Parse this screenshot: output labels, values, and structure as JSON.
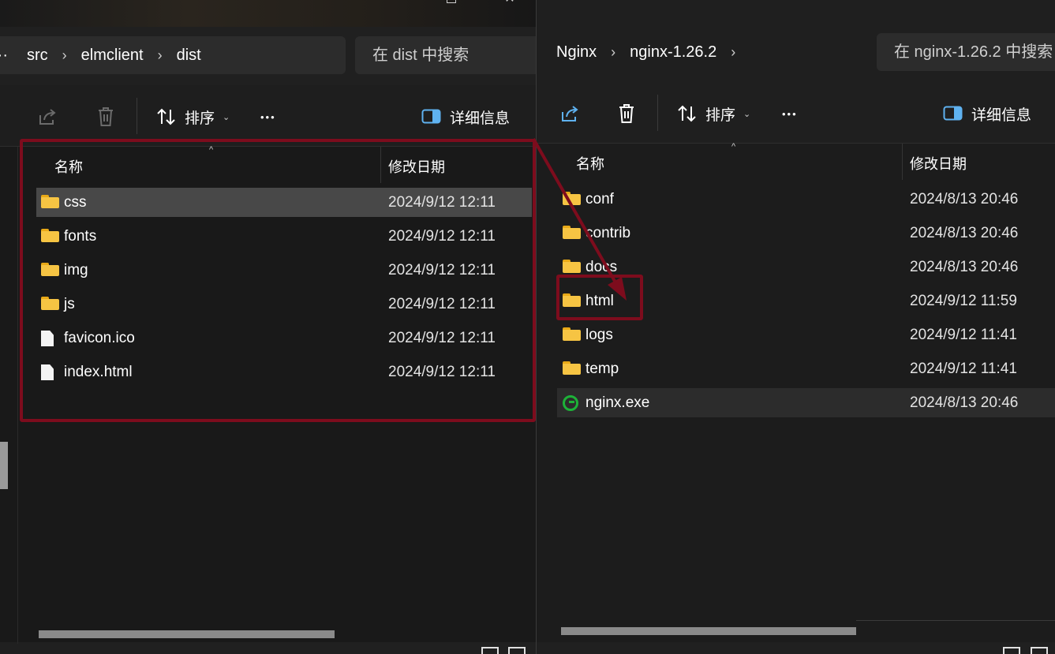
{
  "left_window": {
    "breadcrumb": {
      "overflow_label": "···",
      "items": [
        "src",
        "elmclient",
        "dist"
      ]
    },
    "search_placeholder": "在 dist 中搜索",
    "toolbar": {
      "sort_label": "排序",
      "more_label": "•••",
      "details_label": "详细信息"
    },
    "columns": {
      "name": "名称",
      "modified": "修改日期"
    },
    "files": [
      {
        "name": "css",
        "type": "folder",
        "modified": "2024/9/12 12:11",
        "selected": true
      },
      {
        "name": "fonts",
        "type": "folder",
        "modified": "2024/9/12 12:11"
      },
      {
        "name": "img",
        "type": "folder",
        "modified": "2024/9/12 12:11"
      },
      {
        "name": "js",
        "type": "folder",
        "modified": "2024/9/12 12:11"
      },
      {
        "name": "favicon.ico",
        "type": "file",
        "modified": "2024/9/12 12:11"
      },
      {
        "name": "index.html",
        "type": "file",
        "modified": "2024/9/12 12:11"
      }
    ]
  },
  "right_window": {
    "breadcrumb": {
      "items": [
        "Nginx",
        "nginx-1.26.2"
      ]
    },
    "search_placeholder": "在 nginx-1.26.2 中搜索",
    "toolbar": {
      "sort_label": "排序",
      "more_label": "•••",
      "details_label": "详细信息"
    },
    "columns": {
      "name": "名称",
      "modified": "修改日期"
    },
    "files": [
      {
        "name": "conf",
        "type": "folder",
        "modified": "2024/8/13 20:46"
      },
      {
        "name": "contrib",
        "type": "folder",
        "modified": "2024/8/13 20:46"
      },
      {
        "name": "docs",
        "type": "folder",
        "modified": "2024/8/13 20:46"
      },
      {
        "name": "html",
        "type": "folder",
        "modified": "2024/9/12 11:59"
      },
      {
        "name": "logs",
        "type": "folder",
        "modified": "2024/9/12 11:41"
      },
      {
        "name": "temp",
        "type": "folder",
        "modified": "2024/9/12 11:41"
      },
      {
        "name": "nginx.exe",
        "type": "exe",
        "modified": "2024/8/13 20:46",
        "hover": true
      }
    ]
  },
  "annotation_color": "#7d0c1d",
  "icons": {
    "share": "share-icon",
    "delete": "trash-icon",
    "sort": "sort-arrows-icon",
    "details": "details-pane-icon",
    "folder": "folder-icon",
    "file": "file-icon",
    "exe": "nginx-exe-icon"
  }
}
